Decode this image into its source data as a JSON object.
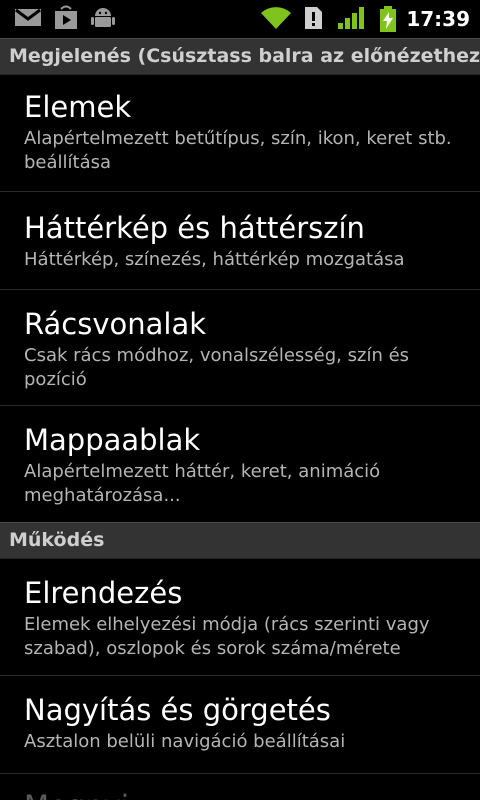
{
  "status_bar": {
    "time": "17:39",
    "icons": [
      "gmail-icon",
      "play-store-icon",
      "android-debug-icon",
      "wifi-icon",
      "alert-icon",
      "signal-icon",
      "battery-charging-icon"
    ]
  },
  "sections": [
    {
      "header": "Megjelenés (Csúsztass balra az előnézethez)",
      "items": [
        {
          "title": "Elemek",
          "summary": "Alapértelmezett betűtípus, szín, ikon, keret stb. beállítása"
        },
        {
          "title": "Háttérkép és háttérszín",
          "summary": "Háttérkép, színezés, háttérkép mozgatása"
        },
        {
          "title": "Rácsvonalak",
          "summary": "Csak rács módhoz, vonalszélesség, szín és pozíció"
        },
        {
          "title": "Mappaablak",
          "summary": "Alapértelmezett háttér, keret, animáció meghatározása..."
        }
      ]
    },
    {
      "header": "Működés",
      "items": [
        {
          "title": "Elrendezés",
          "summary": "Elemek elhelyezési módja (rács szerinti vagy szabad), oszlopok és sorok száma/mérete"
        },
        {
          "title": "Nagyítás és görgetés",
          "summary": "Asztalon belüli navigáció beállításai"
        },
        {
          "title": "Megnyi...",
          "summary": ""
        }
      ]
    }
  ]
}
